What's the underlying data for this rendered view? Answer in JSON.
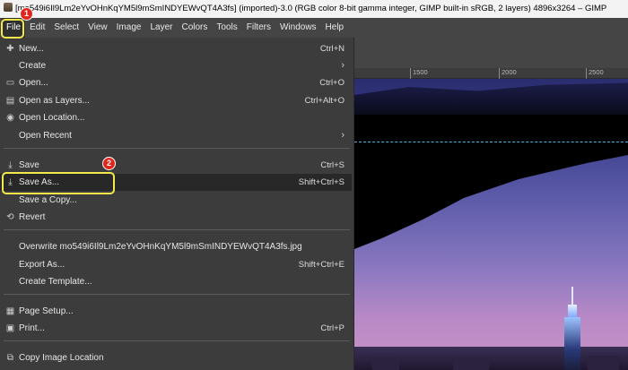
{
  "window": {
    "title": "[mo549i6Il9Lm2eYvOHnKqYM5l9mSmINDYEWvQT4A3fs] (imported)-3.0 (RGB color 8-bit gamma integer, GIMP built-in sRGB, 2 layers) 4896x3264 – GIMP"
  },
  "menubar": [
    "File",
    "Edit",
    "Select",
    "View",
    "Image",
    "Layer",
    "Colors",
    "Tools",
    "Filters",
    "Windows",
    "Help"
  ],
  "ruler": {
    "ticks": [
      "1500",
      "2000",
      "2500"
    ]
  },
  "file_menu": {
    "new": {
      "label": "New...",
      "accel": "Ctrl+N"
    },
    "create": {
      "label": "Create"
    },
    "open": {
      "label": "Open...",
      "accel": "Ctrl+O"
    },
    "open_layers": {
      "label": "Open as Layers...",
      "accel": "Ctrl+Alt+O"
    },
    "open_location": {
      "label": "Open Location..."
    },
    "open_recent": {
      "label": "Open Recent"
    },
    "save": {
      "label": "Save",
      "accel": "Ctrl+S"
    },
    "save_as": {
      "label": "Save As...",
      "accel": "Shift+Ctrl+S"
    },
    "save_copy": {
      "label": "Save a Copy..."
    },
    "revert": {
      "label": "Revert"
    },
    "overwrite": {
      "label": "Overwrite mo549i6Il9Lm2eYvOHnKqYM5l9mSmINDYEWvQT4A3fs.jpg"
    },
    "export_as": {
      "label": "Export As...",
      "accel": "Shift+Ctrl+E"
    },
    "create_template": {
      "label": "Create Template..."
    },
    "page_setup": {
      "label": "Page Setup..."
    },
    "print": {
      "label": "Print...",
      "accel": "Ctrl+P"
    },
    "copy_location": {
      "label": "Copy Image Location"
    }
  },
  "annotations": {
    "step1": "1",
    "step2": "2"
  },
  "colors": {
    "highlight": "#f2e84b",
    "badge": "#e0271d",
    "menu_bg": "#3c3c3c",
    "guide": "#4fb7d8"
  }
}
